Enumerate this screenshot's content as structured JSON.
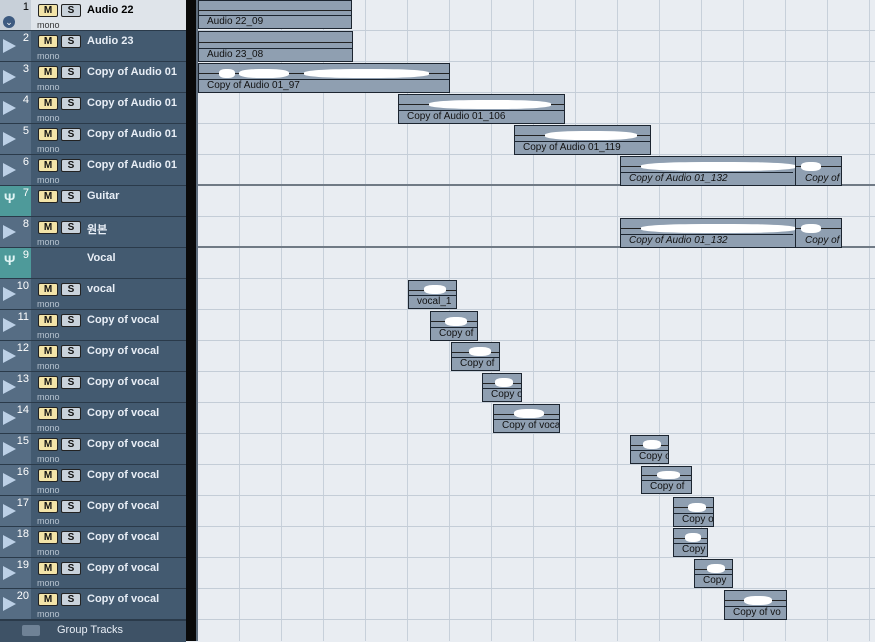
{
  "tracks": [
    {
      "num": "1",
      "name": "Audio 22",
      "mono": "mono",
      "m": "M",
      "s": "S"
    },
    {
      "num": "2",
      "name": "Audio 23",
      "mono": "mono",
      "m": "M",
      "s": "S"
    },
    {
      "num": "3",
      "name": "Copy of Audio 01",
      "mono": "mono",
      "m": "M",
      "s": "S"
    },
    {
      "num": "4",
      "name": "Copy of Audio 01",
      "mono": "mono",
      "m": "M",
      "s": "S"
    },
    {
      "num": "5",
      "name": "Copy of Audio 01",
      "mono": "mono",
      "m": "M",
      "s": "S"
    },
    {
      "num": "6",
      "name": "Copy of Audio 01",
      "mono": "mono",
      "m": "M",
      "s": "S"
    },
    {
      "num": "7",
      "name": "Guitar",
      "m": "M",
      "s": "S"
    },
    {
      "num": "8",
      "name": "원본",
      "mono": "mono",
      "m": "M",
      "s": "S"
    },
    {
      "num": "9",
      "name": "Vocal"
    },
    {
      "num": "10",
      "name": "vocal",
      "mono": "mono",
      "m": "M",
      "s": "S"
    },
    {
      "num": "11",
      "name": "Copy of vocal",
      "mono": "mono",
      "m": "M",
      "s": "S"
    },
    {
      "num": "12",
      "name": "Copy of vocal",
      "mono": "mono",
      "m": "M",
      "s": "S"
    },
    {
      "num": "13",
      "name": "Copy of vocal",
      "mono": "mono",
      "m": "M",
      "s": "S"
    },
    {
      "num": "14",
      "name": "Copy of vocal",
      "mono": "mono",
      "m": "M",
      "s": "S"
    },
    {
      "num": "15",
      "name": "Copy of vocal",
      "mono": "mono",
      "m": "M",
      "s": "S"
    },
    {
      "num": "16",
      "name": "Copy of vocal",
      "mono": "mono",
      "m": "M",
      "s": "S"
    },
    {
      "num": "17",
      "name": "Copy of vocal",
      "mono": "mono",
      "m": "M",
      "s": "S"
    },
    {
      "num": "18",
      "name": "Copy of vocal",
      "mono": "mono",
      "m": "M",
      "s": "S"
    },
    {
      "num": "19",
      "name": "Copy of vocal",
      "mono": "mono",
      "m": "M",
      "s": "S"
    },
    {
      "num": "20",
      "name": "Copy of vocal",
      "mono": "mono",
      "m": "M",
      "s": "S"
    }
  ],
  "group_tracks_label": "Group Tracks",
  "events": [
    {
      "label": "Audio 22_09"
    },
    {
      "label": "Audio 23_08"
    },
    {
      "label": "Copy of Audio 01_97"
    },
    {
      "label": "Copy of Audio 01_106"
    },
    {
      "label": "Copy of Audio 01_119"
    },
    {
      "label": "Copy of Audio 01_132",
      "label2": "Copy of"
    },
    {
      "label": "Copy of Audio 01_132",
      "label2": "Copy of"
    },
    {
      "label": "vocal_1"
    },
    {
      "label": "Copy of"
    },
    {
      "label": "Copy of"
    },
    {
      "label": "Copy o"
    },
    {
      "label": "Copy of vocal"
    },
    {
      "label": "Copy o"
    },
    {
      "label": "Copy of"
    },
    {
      "label": "Copy o"
    },
    {
      "label": "Copy"
    },
    {
      "label": "Copy"
    },
    {
      "label": "Copy of vo"
    }
  ],
  "colors": {
    "track_bg": "#435a70",
    "track_selected_bg": "#dfe4ea",
    "group_track_color": "#4e9a9a",
    "mute_button": "#f3e4a8",
    "event_bg": "#8f9fb1",
    "arrange_bg": "#e9edf2"
  },
  "icons": {
    "track_arrow": "play-triangle-icon",
    "folder": "folder-icon",
    "group": "group-track-icon",
    "collapse": "chevron-down-icon"
  }
}
